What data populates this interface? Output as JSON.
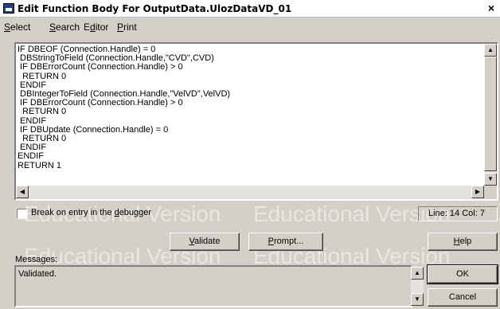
{
  "window": {
    "title": "Edit Function Body For OutputData.UlozDataVD_01",
    "close_glyph": "×"
  },
  "menu": [
    {
      "label": "Select",
      "accel": "S",
      "rest": "elect"
    },
    {
      "label": "Search",
      "accel": "S",
      "rest": "earch"
    },
    {
      "label": "Editor",
      "pre": "E",
      "accel": "d",
      "rest": "itor"
    },
    {
      "label": "Print",
      "accel": "P",
      "rest": "rint"
    }
  ],
  "editor": {
    "code": "IF DBEOF (Connection.Handle) = 0\n DBStringToField (Connection.Handle,\"CVD\",CVD)\n IF DBErrorCount (Connection.Handle) > 0\n  RETURN 0\n ENDIF\n DBIntegerToField (Connection.Handle,\"VelVD\",VelVD)\n IF DBErrorCount (Connection.Handle) > 0\n  RETURN 0\n ENDIF\n IF DBUpdate (Connection.Handle) = 0\n  RETURN 0\n ENDIF\nENDIF\nRETURN 1"
  },
  "debugger": {
    "label_pre": "Break on entry in the ",
    "label_accel": "d",
    "label_post": "ebugger",
    "checked": false
  },
  "status": {
    "line_col": "Line: 14 Col: 7"
  },
  "watermark": {
    "text": "Educational Version"
  },
  "buttons": {
    "validate": {
      "accel": "V",
      "rest": "alidate"
    },
    "prompt": {
      "accel": "P",
      "rest": "rompt..."
    },
    "help": {
      "accel": "H",
      "rest": "elp"
    },
    "ok": "OK",
    "cancel": "Cancel"
  },
  "messages": {
    "label": "Messages:",
    "text": "Validated."
  },
  "icons": {
    "scroll_up": "▲",
    "scroll_down": "▼",
    "scroll_left": "◀",
    "scroll_right": "▶"
  }
}
